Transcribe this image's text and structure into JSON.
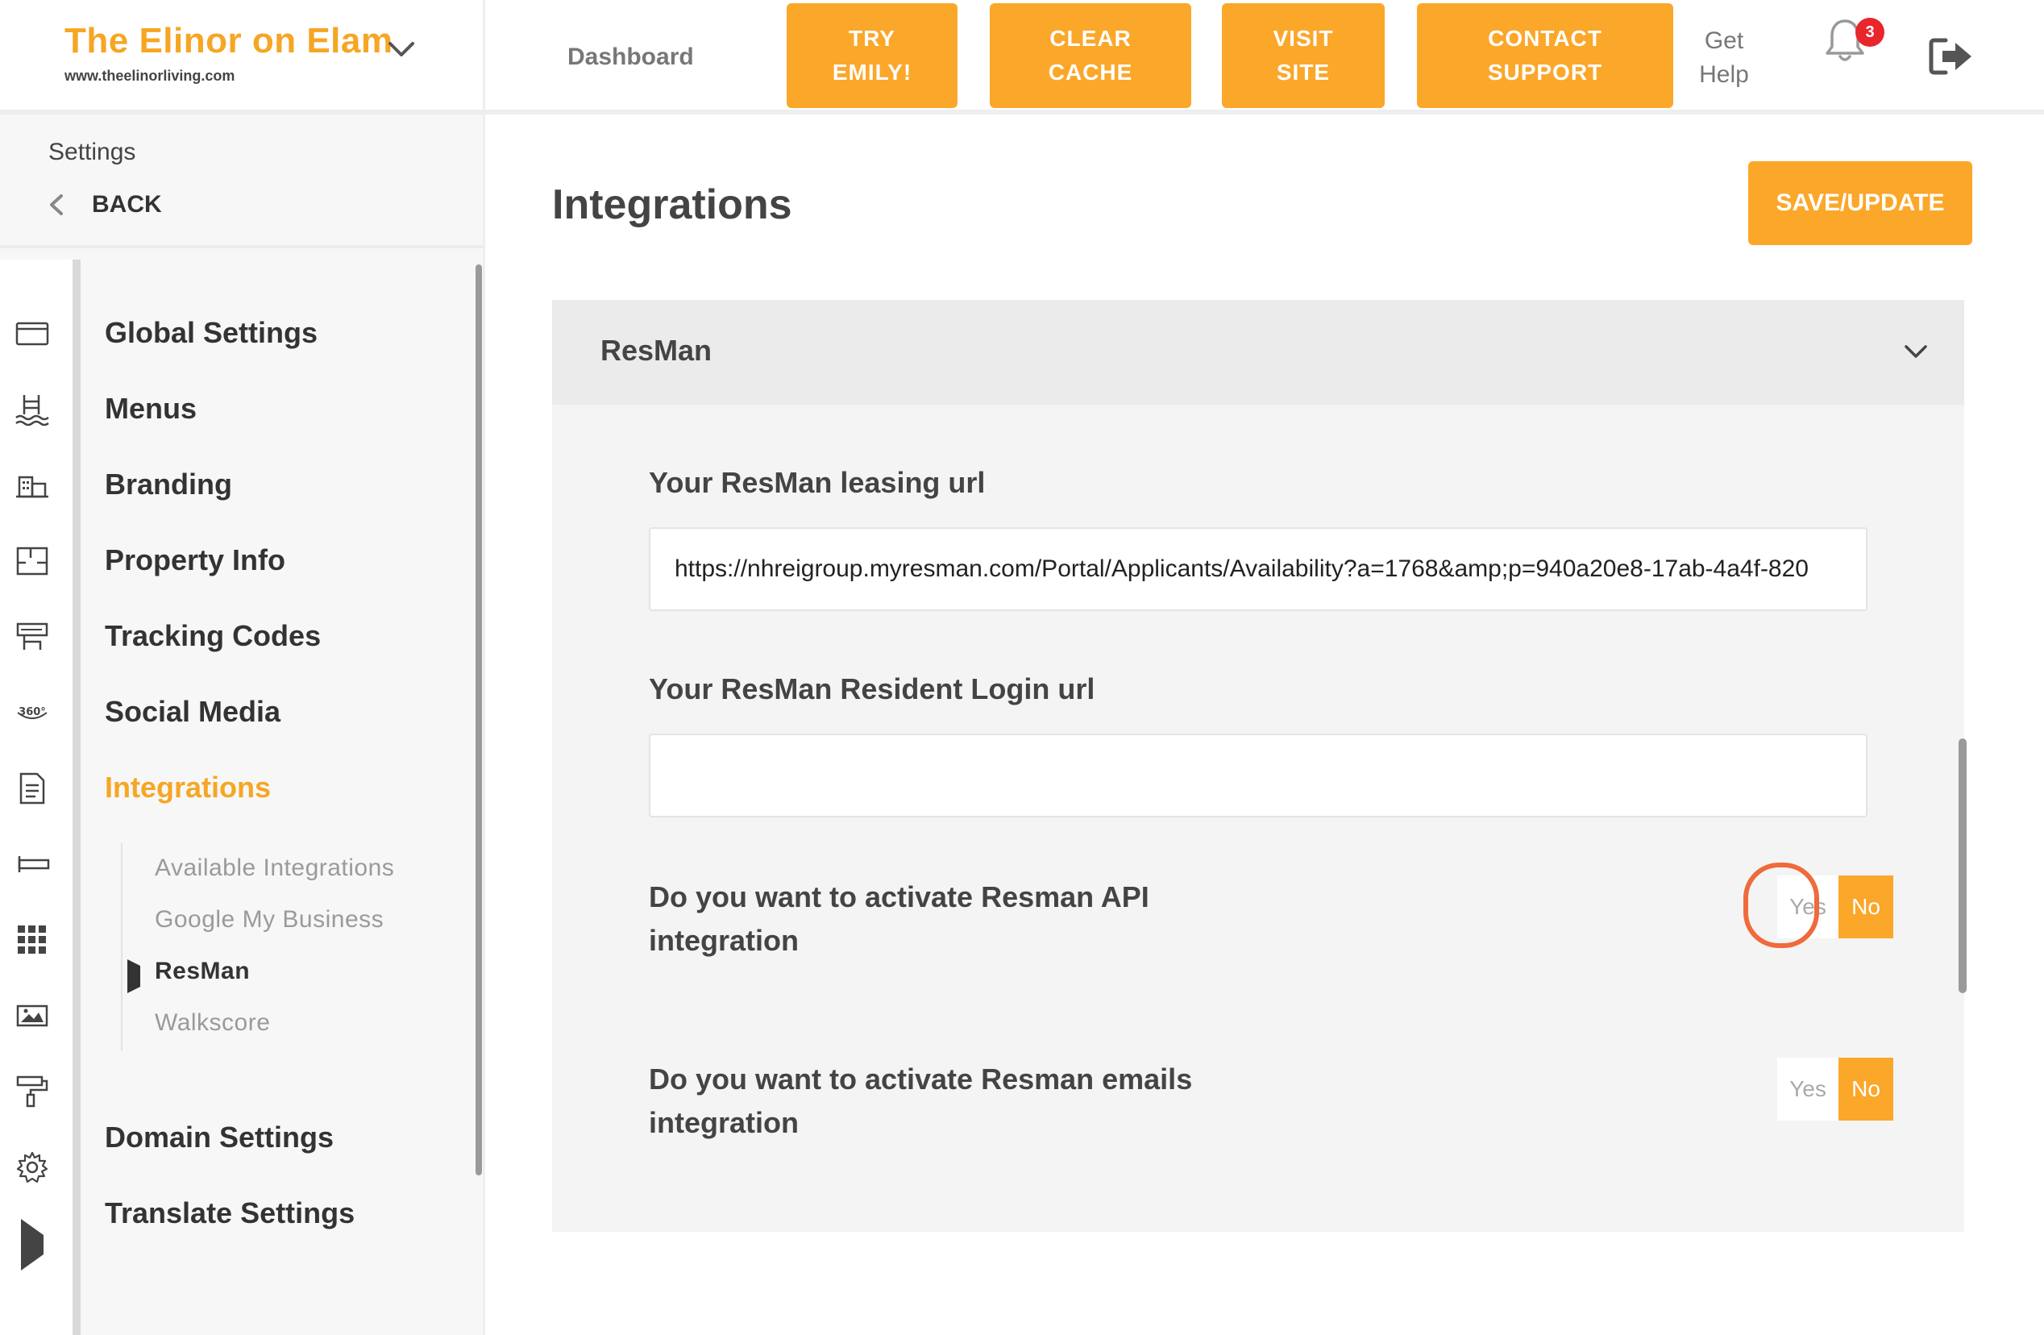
{
  "header": {
    "property_name": "The Elinor on Elam",
    "property_url": "www.theelinorliving.com",
    "dashboard_label": "Dashboard",
    "buttons": [
      {
        "label": "TRY\nEMILY!"
      },
      {
        "label": "CLEAR\nCACHE"
      },
      {
        "label": "VISIT\nSITE"
      },
      {
        "label": "CONTACT\nSUPPORT"
      }
    ],
    "get_help_label": "Get\nHelp",
    "notification_count": "3",
    "accent_color": "#fba72a"
  },
  "sidebar": {
    "section_title": "Settings",
    "back_label": "BACK",
    "rail_icons": [
      "browser-window-icon",
      "pool-icon",
      "buildings-icon",
      "floorplan-icon",
      "tracking-icon",
      "360-view-icon",
      "document-icon",
      "amenities-icon",
      "grid-icon",
      "gallery-icon",
      "paint-roller-icon",
      "gear-icon",
      "play-marker-icon"
    ],
    "items": [
      {
        "label": "Global Settings"
      },
      {
        "label": "Menus"
      },
      {
        "label": "Branding"
      },
      {
        "label": "Property Info"
      },
      {
        "label": "Tracking Codes"
      },
      {
        "label": "Social Media"
      },
      {
        "label": "Integrations",
        "active": true
      },
      {
        "label": "Domain Settings"
      },
      {
        "label": "Translate Settings"
      }
    ],
    "subitems": [
      {
        "label": "Available Integrations"
      },
      {
        "label": "Google My Business"
      },
      {
        "label": "ResMan",
        "current": true
      },
      {
        "label": "Walkscore"
      }
    ]
  },
  "main": {
    "title": "Integrations",
    "save_label": "SAVE/UPDATE",
    "panel": {
      "title": "ResMan",
      "leasing_url_label": "Your ResMan leasing url",
      "leasing_url_value": "https://nhreigroup.myresman.com/Portal/Applicants/Availability?a=1768&amp;p=940a20e8-17ab-4a4f-820",
      "resident_login_label": "Your ResMan Resident Login url",
      "resident_login_value": "",
      "api_question": "Do you want to activate Resman API integration",
      "emails_question": "Do you want to activate Resman emails integration",
      "yes_label": "Yes",
      "no_label": "No",
      "api_selected": "No",
      "emails_selected": "No"
    }
  }
}
